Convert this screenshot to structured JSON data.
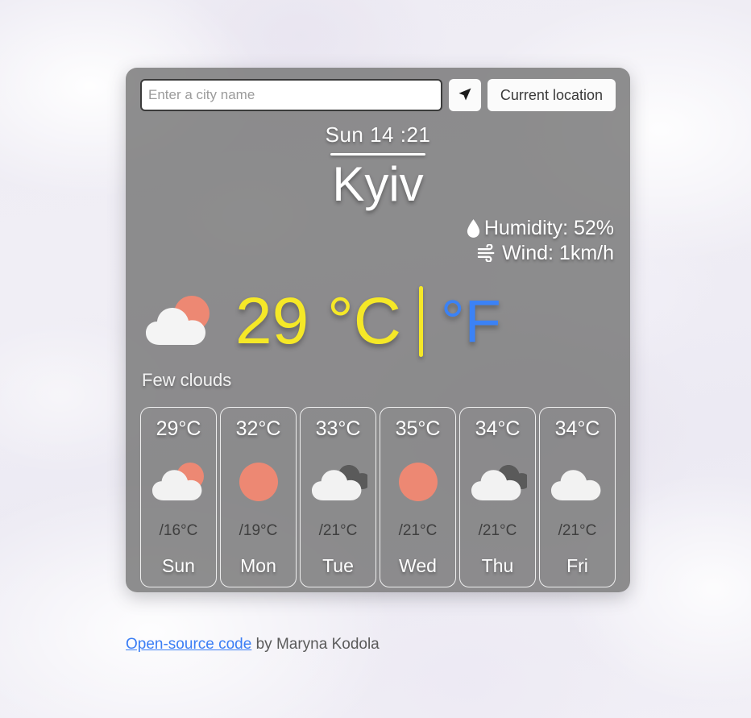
{
  "search": {
    "placeholder": "Enter a city name",
    "value": "",
    "geo_icon": "navigation-arrow-icon",
    "current_location_label": "Current location"
  },
  "current": {
    "datetime": "Sun 14 :21",
    "city": "Kyiv",
    "humidity_icon": "water-drop-icon",
    "humidity_label": "Humidity: 52%",
    "wind_icon": "wind-icon",
    "wind_label": "Wind: 1km/h",
    "icon": "few-clouds-icon",
    "temperature": "29 °C",
    "unit_fahrenheit": "°F",
    "description": "Few clouds"
  },
  "forecast": [
    {
      "max": "29°C",
      "min": "/16°C",
      "day": "Sun",
      "icon": "few-clouds-icon"
    },
    {
      "max": "32°C",
      "min": "/19°C",
      "day": "Mon",
      "icon": "clear-sun-icon"
    },
    {
      "max": "33°C",
      "min": "/21°C",
      "day": "Tue",
      "icon": "broken-clouds-icon"
    },
    {
      "max": "35°C",
      "min": "/21°C",
      "day": "Wed",
      "icon": "clear-sun-icon"
    },
    {
      "max": "34°C",
      "min": "/21°C",
      "day": "Thu",
      "icon": "broken-clouds-icon"
    },
    {
      "max": "34°C",
      "min": "/21°C",
      "day": "Fri",
      "icon": "cloud-icon"
    }
  ],
  "footer": {
    "link_label": "Open-source code",
    "credit": " by Maryna Kodola"
  },
  "colors": {
    "panel": "#787878",
    "temp_celsius": "#f5e827",
    "temp_fahrenheit": "#3b82f6",
    "sun": "#ed8873",
    "cloud_white": "#f2f2f2",
    "cloud_dark": "#5a5a5a",
    "link": "#3b7ef5"
  }
}
